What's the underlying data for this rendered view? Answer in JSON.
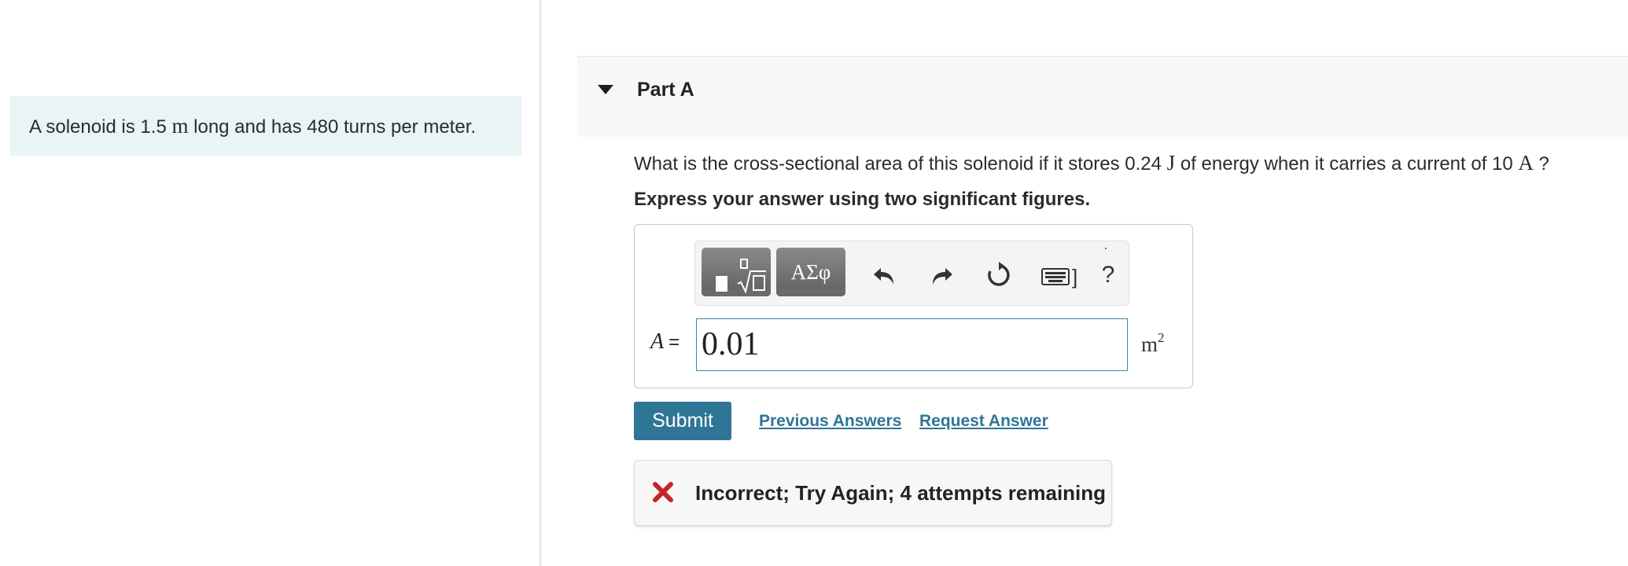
{
  "problem": {
    "intro_before": "A solenoid is 1.5 ",
    "intro_unit": "m",
    "intro_after": " long and has 480 turns per meter."
  },
  "part": {
    "title": "Part A",
    "question_before": "What is the cross-sectional area of this solenoid if it stores 0.24 ",
    "question_unit_energy": "J",
    "question_middle": " of energy when it carries a current of 10 ",
    "question_unit_current": "A",
    "question_after": " ?",
    "instruction": "Express your answer using two significant figures."
  },
  "toolbar": {
    "greek_label": "ΑΣφ",
    "keyboard_suffix": "]",
    "help_label": "?"
  },
  "answer": {
    "variable": "A",
    "equals": "=",
    "value": "0.01",
    "unit_base": "m",
    "unit_exponent": "2"
  },
  "actions": {
    "submit": "Submit",
    "previous_answers": "Previous Answers",
    "request_answer": "Request Answer"
  },
  "feedback": {
    "message": "Incorrect; Try Again; 4 attempts remaining",
    "status": "incorrect"
  },
  "colors": {
    "accent": "#2f7596",
    "intro_bg": "#e8f4f5",
    "error": "#c9242b"
  }
}
